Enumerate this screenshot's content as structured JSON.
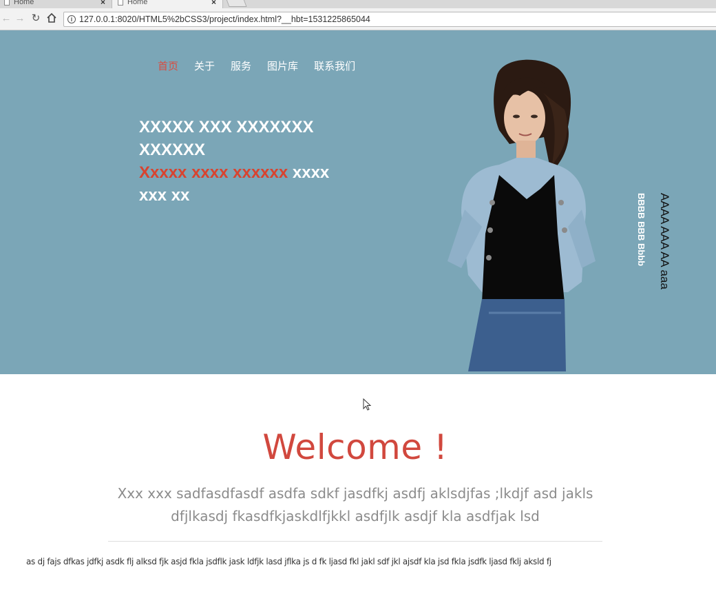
{
  "browser": {
    "tabs": [
      {
        "title": "Home"
      },
      {
        "title": "Home"
      }
    ],
    "close_glyph": "×",
    "url": "127.0.0.1:8020/HTML5%2bCSS3/project/index.html?__hbt=1531225865044",
    "icons": {
      "back": "back-arrow-icon",
      "forward": "forward-arrow-icon",
      "reload": "reload-icon",
      "home": "home-icon",
      "info": "info-icon"
    }
  },
  "hero": {
    "background": "#7ba6b7",
    "nav": [
      {
        "label": "首页",
        "active": true
      },
      {
        "label": "关于",
        "active": false
      },
      {
        "label": "服务",
        "active": false
      },
      {
        "label": "图片库",
        "active": false
      },
      {
        "label": "联系我们",
        "active": false
      }
    ],
    "headline_white": "XXXXX XXX XXXXXXX XXXXXX",
    "headline_red": "Xxxxx xxxx xxxxxx",
    "headline_tail": "xxxx xxx xx",
    "vertical_text_1": "AAAA AAA AA aaa",
    "vertical_text_2": "BBBB BBB Bbbb"
  },
  "main": {
    "welcome": "Welcome !",
    "lead": "Xxx xxx sadfasdfasdf asdfa sdkf jasdfkj asdfj aklsdjfas ;lkdjf asd jakls dfjlkasdj fkasdfkjaskdlfjkkl asdfjlk asdjf kla asdfjak lsd",
    "body": "as dj fajs dfkas jdfkj asdk flj alksd fjk asjd fkla jsdflk jask ldfjk lasd jflka js d fk ljasd fkl jakl sdf jkl ajsdf kla jsd fkla jsdfk ljasd fklj aksld fj"
  },
  "colors": {
    "accent": "#d1483e",
    "hero_bg": "#7ba6b7"
  }
}
